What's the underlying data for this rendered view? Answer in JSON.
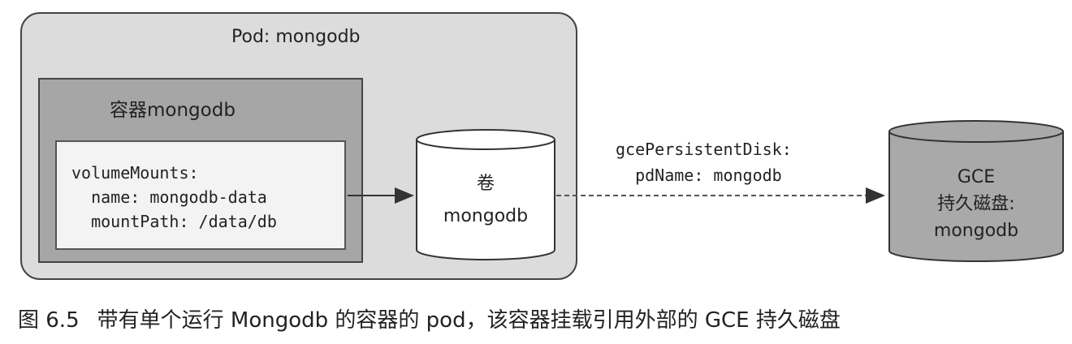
{
  "pod": {
    "title": "Pod: mongodb"
  },
  "container": {
    "title": "容器mongodb",
    "code_lines": [
      "volumeMounts:",
      "  name: mongodb-data",
      "  mountPath: /data/db"
    ]
  },
  "volume": {
    "line1": "卷",
    "line2": "mongodb"
  },
  "connection": {
    "line1": "gcePersistentDisk:",
    "line2": "  pdName: mongodb"
  },
  "disk": {
    "line1": "GCE",
    "line2": "持久磁盘:",
    "line3": "mongodb"
  },
  "caption": {
    "figure_number": "图 6.5",
    "text": "带有单个运行 Mongodb 的容器的 pod，该容器挂载引用外部的 GCE 持久磁盘"
  },
  "colors": {
    "pod_fill": "#dcdcdc",
    "container_fill": "#a6a6a6",
    "code_fill": "#f3f3f3",
    "volume_fill": "#ffffff",
    "disk_fill": "#a9a9a9"
  }
}
